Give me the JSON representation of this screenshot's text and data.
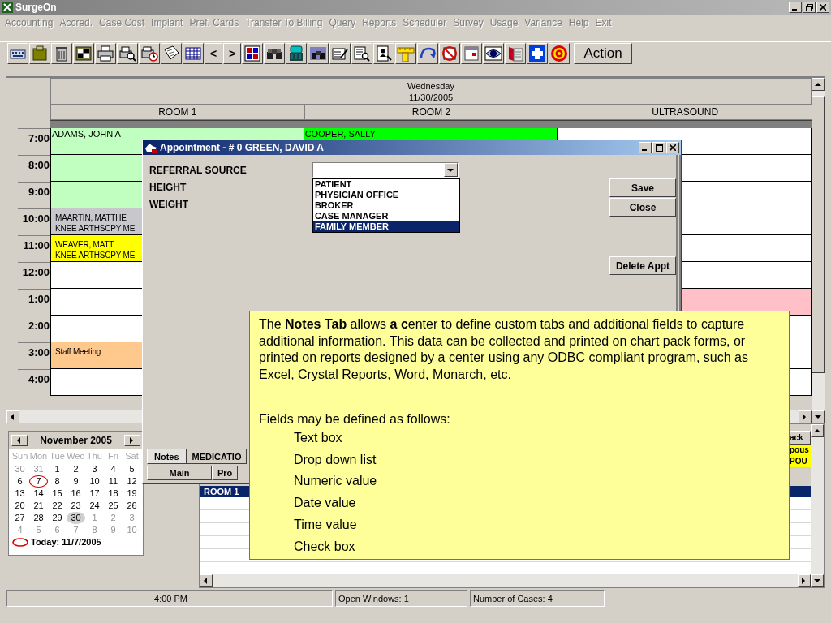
{
  "window": {
    "title": "SurgeOn"
  },
  "menu": [
    "Accounting",
    "Accred.",
    "Case Cost",
    "Implant",
    "Pref. Cards",
    "Transfer To Billing",
    "Query",
    "Reports",
    "Scheduler",
    "Survey",
    "Usage",
    "Variance",
    "Help",
    "Exit"
  ],
  "toolbar": {
    "prev": "<",
    "next": ">",
    "action": "Action"
  },
  "schedule": {
    "day": "Wednesday",
    "date": "11/30/2005",
    "times": [
      "7:00",
      "8:00",
      "9:00",
      "10:00",
      "11:00",
      "12:00",
      "1:00",
      "2:00",
      "3:00",
      "4:00"
    ],
    "rooms": [
      {
        "name": "ROOM 1",
        "slots": [
          {
            "color": "#c0ffc0",
            "lines": [
              "ADAMS, JOHN A"
            ]
          },
          {
            "color": "#c0ffc0"
          },
          {
            "color": "#c0ffc0"
          },
          {
            "color": "#c8c8cc",
            "lines": [
              "MAARTIN, MATTHE",
              "KNEE ARTHSCPY ME"
            ]
          },
          {
            "color": "#ffff00",
            "lines": [
              "WEAVER, MATT",
              "KNEE ARTHSCPY ME"
            ]
          },
          {
            "color": "#ffffff"
          },
          {
            "color": "#ffffff"
          },
          {
            "color": "#ffffff"
          },
          {
            "color": "#ffc88c",
            "lines": [
              "Staff Meeting"
            ]
          },
          {
            "color": "#ffffff"
          }
        ]
      },
      {
        "name": "ROOM 2",
        "slots": [
          {
            "color": "#00ff00",
            "lines": [
              "COOPER, SALLY"
            ]
          }
        ]
      },
      {
        "name": "ULTRASOUND",
        "slots": [
          {
            "color": "#ffffff"
          },
          {
            "color": "#ffffff"
          },
          {
            "color": "#ffffff"
          },
          {
            "color": "#ffffff"
          },
          {
            "color": "#ffffff"
          },
          {
            "color": "#ffffff"
          },
          {
            "color": "#ffc0c8"
          },
          {
            "color": "#ffffff"
          },
          {
            "color": "#ffffff"
          },
          {
            "color": "#ffffff"
          }
        ]
      }
    ]
  },
  "calendar": {
    "month": "November 2005",
    "weekdays": [
      "Sun",
      "Mon",
      "Tue",
      "Wed",
      "Thu",
      "Fri",
      "Sat"
    ],
    "days": [
      {
        "label": "30",
        "muted": true,
        "selected": false,
        "today": false
      },
      {
        "label": "31",
        "muted": true,
        "selected": false,
        "today": false
      },
      {
        "label": "1",
        "muted": false,
        "selected": false,
        "today": false
      },
      {
        "label": "2",
        "muted": false,
        "selected": false,
        "today": false
      },
      {
        "label": "3",
        "muted": false,
        "selected": false,
        "today": false
      },
      {
        "label": "4",
        "muted": false,
        "selected": false,
        "today": false
      },
      {
        "label": "5",
        "muted": false,
        "selected": false,
        "today": false
      },
      {
        "label": "6",
        "muted": false,
        "selected": false,
        "today": false
      },
      {
        "label": "7",
        "muted": false,
        "selected": false,
        "today": true
      },
      {
        "label": "8",
        "muted": false,
        "selected": false,
        "today": false
      },
      {
        "label": "9",
        "muted": false,
        "selected": false,
        "today": false
      },
      {
        "label": "10",
        "muted": false,
        "selected": false,
        "today": false
      },
      {
        "label": "11",
        "muted": false,
        "selected": false,
        "today": false
      },
      {
        "label": "12",
        "muted": false,
        "selected": false,
        "today": false
      },
      {
        "label": "13",
        "muted": false,
        "selected": false,
        "today": false
      },
      {
        "label": "14",
        "muted": false,
        "selected": false,
        "today": false
      },
      {
        "label": "15",
        "muted": false,
        "selected": false,
        "today": false
      },
      {
        "label": "16",
        "muted": false,
        "selected": false,
        "today": false
      },
      {
        "label": "17",
        "muted": false,
        "selected": false,
        "today": false
      },
      {
        "label": "18",
        "muted": false,
        "selected": false,
        "today": false
      },
      {
        "label": "19",
        "muted": false,
        "selected": false,
        "today": false
      },
      {
        "label": "20",
        "muted": false,
        "selected": false,
        "today": false
      },
      {
        "label": "21",
        "muted": false,
        "selected": false,
        "today": false
      },
      {
        "label": "22",
        "muted": false,
        "selected": false,
        "today": false
      },
      {
        "label": "23",
        "muted": false,
        "selected": false,
        "today": false
      },
      {
        "label": "24",
        "muted": false,
        "selected": false,
        "today": false
      },
      {
        "label": "25",
        "muted": false,
        "selected": false,
        "today": false
      },
      {
        "label": "26",
        "muted": false,
        "selected": false,
        "today": false
      },
      {
        "label": "27",
        "muted": false,
        "selected": false,
        "today": false
      },
      {
        "label": "28",
        "muted": false,
        "selected": false,
        "today": false
      },
      {
        "label": "29",
        "muted": false,
        "selected": false,
        "today": false
      },
      {
        "label": "30",
        "muted": false,
        "selected": true,
        "today": false
      },
      {
        "label": "1",
        "muted": true,
        "selected": false,
        "today": false
      },
      {
        "label": "2",
        "muted": true,
        "selected": false,
        "today": false
      },
      {
        "label": "3",
        "muted": true,
        "selected": false,
        "today": false
      },
      {
        "label": "4",
        "muted": true,
        "selected": false,
        "today": false
      },
      {
        "label": "5",
        "muted": true,
        "selected": false,
        "today": false
      },
      {
        "label": "6",
        "muted": true,
        "selected": false,
        "today": false
      },
      {
        "label": "7",
        "muted": true,
        "selected": false,
        "today": false
      },
      {
        "label": "8",
        "muted": true,
        "selected": false,
        "today": false
      },
      {
        "label": "9",
        "muted": true,
        "selected": false,
        "today": false
      },
      {
        "label": "10",
        "muted": true,
        "selected": false,
        "today": false
      }
    ],
    "today": "Today: 11/7/2005"
  },
  "dialog": {
    "title": "Appointment - # 0 GREEN, DAVID A",
    "fields": [
      "REFERRAL SOURCE",
      "HEIGHT",
      "WEIGHT"
    ],
    "options": [
      {
        "label": "PATIENT",
        "selected": false
      },
      {
        "label": "PHYSICIAN OFFICE",
        "selected": false
      },
      {
        "label": "BROKER",
        "selected": false
      },
      {
        "label": "CASE MANAGER",
        "selected": false
      },
      {
        "label": "FAMILY MEMBER",
        "selected": true
      }
    ],
    "buttons": [
      "Save",
      "Close",
      "Delete Appt"
    ],
    "tab_rows": [
      [
        {
          "label": "Notes",
          "selected": true
        },
        {
          "label": "MEDICATIO",
          "selected": false
        }
      ],
      [
        {
          "label": "Main",
          "selected": false
        },
        {
          "label": "Pro",
          "selected": false
        }
      ]
    ]
  },
  "case_window": {
    "column_header": "ack",
    "cells": [
      "pous",
      "POU"
    ],
    "row_label": "ROOM 1"
  },
  "callout": {
    "paragraph": "The **Notes Tab** allows **a c**enter to define custom tabs and additional fields to capture additional information. This data can be collected and printed on chart pack forms, or printed on reports designed by a center using any ODBC compliant program, such as Excel, Crystal Reports, Word, Monarch, etc.",
    "lead": "Fields may be defined as follows:",
    "items": [
      "Text box",
      "Drop down list",
      "Numeric value",
      "Date value",
      "Time value",
      "Check box"
    ]
  },
  "status_bar": [
    "4:00 PM",
    "Open Windows: 1",
    "Number of Cases: 4"
  ]
}
